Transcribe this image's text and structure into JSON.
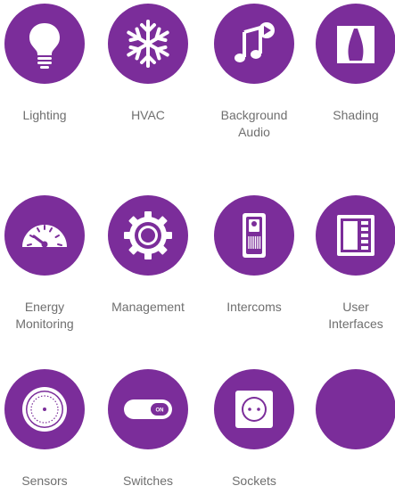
{
  "theme": {
    "accent": "#7b2d9a",
    "text": "#6f6f6f",
    "background": "#ffffff"
  },
  "categories": [
    {
      "label": "Lighting",
      "icon": "lightbulb-icon"
    },
    {
      "label": "HVAC",
      "icon": "snowflake-icon"
    },
    {
      "label": "Background\nAudio",
      "icon": "music-play-icon"
    },
    {
      "label": "Shading",
      "icon": "curtains-icon"
    },
    {
      "label": "Energy\nMonitoring",
      "icon": "gauge-icon"
    },
    {
      "label": "Management",
      "icon": "gear-icon"
    },
    {
      "label": "Intercoms",
      "icon": "intercom-icon"
    },
    {
      "label": "User\nInterfaces",
      "icon": "keypad-panel-icon"
    },
    {
      "label": "Sensors",
      "icon": "sensor-icon"
    },
    {
      "label": "Switches",
      "icon": "toggle-switch-icon"
    },
    {
      "label": "Sockets",
      "icon": "socket-icon"
    },
    {
      "label": "",
      "icon": ""
    }
  ],
  "switch_on_text": "ON"
}
